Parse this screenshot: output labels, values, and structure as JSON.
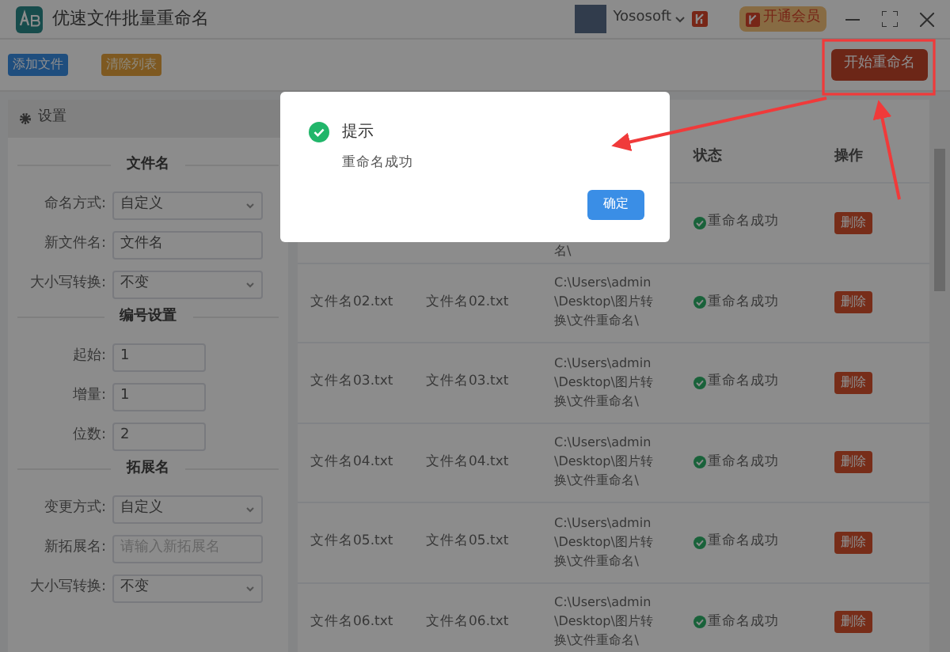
{
  "window": {
    "title": "优速文件批量重命名",
    "user": "Yososoft",
    "vip_button": "开通会员"
  },
  "toolbar": {
    "buttons": [
      {
        "label": "添加文件",
        "kind": "blue"
      },
      {
        "label": "清除列表",
        "kind": "orange"
      }
    ],
    "start_button": "开始重命名"
  },
  "settings": {
    "title": "设置",
    "sections": [
      {
        "title": "文件名",
        "fields": [
          {
            "label": "命名方式:",
            "kind": "select",
            "value": "自定义"
          },
          {
            "label": "新文件名:",
            "kind": "input",
            "value": "文件名"
          },
          {
            "label": "大小写转换:",
            "kind": "select",
            "value": "不变"
          }
        ]
      },
      {
        "title": "编号设置",
        "fields": [
          {
            "label": "起始:",
            "kind": "short",
            "value": "1"
          },
          {
            "label": "增量:",
            "kind": "short",
            "value": "1"
          },
          {
            "label": "位数:",
            "kind": "short",
            "value": "2"
          }
        ]
      },
      {
        "title": "拓展名",
        "fields": [
          {
            "label": "变更方式:",
            "kind": "select",
            "value": "自定义"
          },
          {
            "label": "新拓展名:",
            "kind": "input",
            "placeholder": "请输入新拓展名"
          },
          {
            "label": "大小写转换:",
            "kind": "select",
            "value": "不变"
          }
        ]
      }
    ]
  },
  "table": {
    "columns": [
      {
        "label": "状态"
      },
      {
        "label": "操作"
      }
    ],
    "rows": [
      {
        "path": "名\\",
        "status": "重命名成功",
        "action": "删除"
      },
      {
        "name": "文件名02.txt",
        "new_name": "文件名02.txt",
        "path": "C:\\Users\\admin\\Desktop\\图片转换\\文件重命名\\",
        "status": "重命名成功",
        "action": "删除"
      },
      {
        "name": "文件名03.txt",
        "new_name": "文件名03.txt",
        "path": "C:\\Users\\admin\\Desktop\\图片转换\\文件重命名\\",
        "status": "重命名成功",
        "action": "删除"
      },
      {
        "name": "文件名04.txt",
        "new_name": "文件名04.txt",
        "path": "C:\\Users\\admin\\Desktop\\图片转换\\文件重命名\\",
        "status": "重命名成功",
        "action": "删除"
      },
      {
        "name": "文件名05.txt",
        "new_name": "文件名05.txt",
        "path": "C:\\Users\\admin\\Desktop\\图片转换\\文件重命名\\",
        "status": "重命名成功",
        "action": "删除"
      },
      {
        "name": "文件名06.txt",
        "new_name": "文件名06.txt",
        "path": "C:\\Users\\admin\\Desktop\\图片转换\\文件重命名\\",
        "status": "重命名成功",
        "action": "删除"
      }
    ]
  },
  "dialog": {
    "title": "提示",
    "message": "重命名成功",
    "button": "确定"
  }
}
